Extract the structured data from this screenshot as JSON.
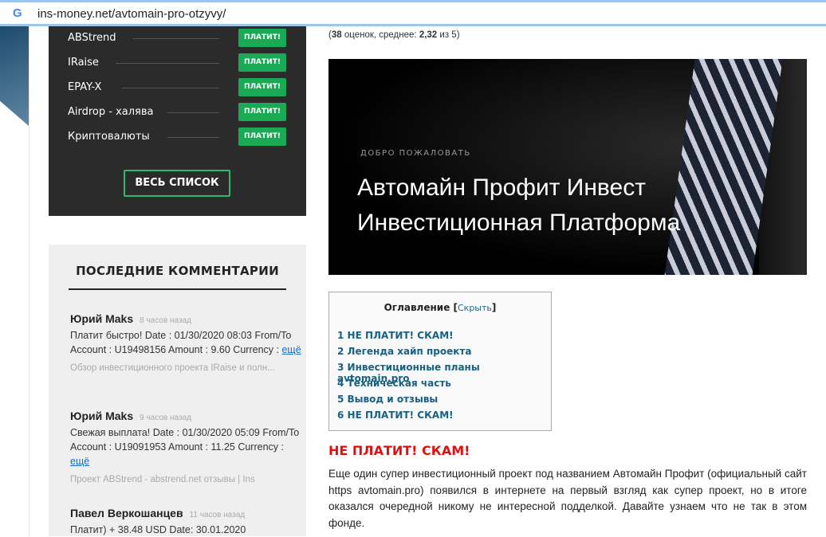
{
  "address_bar": {
    "url": "ins-money.net/avtomain-pro-otzyvy/"
  },
  "projects": {
    "items": [
      {
        "name": "ABStrend",
        "status": "ПЛАТИТ!"
      },
      {
        "name": "IRaise",
        "status": "ПЛАТИТ!"
      },
      {
        "name": "EPAY-X",
        "status": "ПЛАТИТ!"
      },
      {
        "name": "Airdrop - халява",
        "status": "ПЛАТИТ!"
      },
      {
        "name": "Криптовалюты",
        "status": "ПЛАТИТ!"
      }
    ],
    "all_label": "ВЕСЬ СПИСОК"
  },
  "comments": {
    "title": "ПОСЛЕДНИЕ КОММЕНТАРИИ",
    "items": [
      {
        "author": "Юрий Maks",
        "time": "8 часов назад",
        "text": "Платит быстро! Date : 01/30/2020 08:03 From/To Account : U19498156 Amount : 9.60 Currency :",
        "more": "ещё",
        "source": "Обзор инвестиционного проекта IRaise и полн..."
      },
      {
        "author": "Юрий Maks",
        "time": "9 часов назад",
        "text": "Свежая выплата! Date : 01/30/2020 05:09 From/To Account : U19091953 Amount : 11.25 Currency :",
        "more": "ещё",
        "source": "Проект ABStrend - abstrend.net отзывы | Ins"
      },
      {
        "author": "Павел Веркошанцев",
        "time": "11 часов назад",
        "text": "Платит) + 38.48 USD Date: 30.01.2020"
      }
    ]
  },
  "rating": {
    "count": "38",
    "count_label": "оценок, среднее:",
    "avg": "2,32",
    "of": "из 5"
  },
  "hero": {
    "welcome": "ДОБРО ПОЖАЛОВАТЬ",
    "title1": "Автомайн Профит Инвест",
    "title2": "Инвестиционная Платформа"
  },
  "toc": {
    "title": "Оглавление",
    "toggle": "Скрыть",
    "items": [
      "1 НЕ ПЛАТИТ! СКАМ!",
      "2 Легенда хайп проекта",
      "3 Инвестиционные планы avtomain.pro",
      "4 Техническая часть",
      "5 Вывод и отзывы",
      "6 НЕ ПЛАТИТ! СКАМ!"
    ]
  },
  "article": {
    "heading": "НЕ ПЛАТИТ! СКАМ!",
    "paragraph": "Еще один супер инвестиционный проект под названием Автомайн Профит (официальный сайт https avtomain.pro) появился в интернете на первый взгляд как супер проект, но в итоге оказался очередной никому не интересной подделкой. Давайте узнаем что не так в этом фонде."
  }
}
